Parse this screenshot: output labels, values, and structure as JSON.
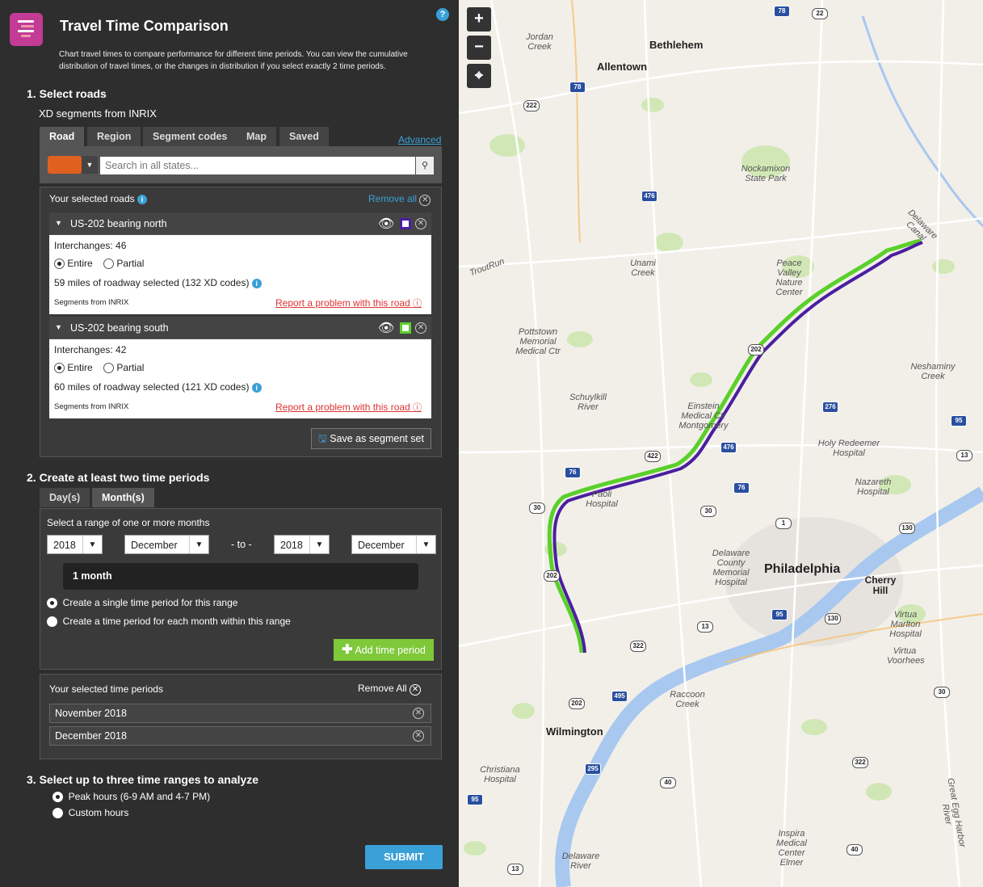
{
  "header": {
    "title": "Travel Time Comparison",
    "help": "?",
    "description": "Chart travel times to compare performance for different time periods. You can view the cumulative distribution of travel times, or the changes in distribution if you select exactly 2 time periods."
  },
  "step1": {
    "heading": "1. Select roads",
    "source": "XD segments from  INRIX",
    "tabs": [
      "Road",
      "Region",
      "Segment codes",
      "Map",
      "Saved"
    ],
    "active_tab": "Road",
    "advanced": "Advanced",
    "search_placeholder": "Search in all states...",
    "selected_label": "Your selected roads",
    "remove_all": "Remove all",
    "roads": [
      {
        "name": "US-202 bearing north",
        "interchanges": "Interchanges: 46",
        "entire": "Entire",
        "partial": "Partial",
        "miles": "59 miles of roadway selected (132 XD codes)",
        "segments_from": "Segments from INRIX",
        "report": "Report a problem with this road",
        "color": "#4b1fa0"
      },
      {
        "name": "US-202 bearing south",
        "interchanges": "Interchanges: 42",
        "entire": "Entire",
        "partial": "Partial",
        "miles": "60 miles of roadway selected (121 XD codes)",
        "segments_from": "Segments from INRIX",
        "report": "Report a problem with this road",
        "color": "#5ad02a"
      }
    ],
    "save_set": "Save as segment set"
  },
  "step2": {
    "heading": "2. Create at least two time periods",
    "tabs": [
      "Day(s)",
      "Month(s)"
    ],
    "active_tab": "Month(s)",
    "range_label": "Select a range of one or more months",
    "from_year": "2018",
    "from_month": "December",
    "to_label": "- to -",
    "to_year": "2018",
    "to_month": "December",
    "duration": "1 month",
    "option_single": "Create a single time period for this range",
    "option_each": "Create a time period for each month within this range",
    "add_period": "Add time period",
    "selected_label": "Your selected time periods",
    "remove_all": "Remove All",
    "periods": [
      "November 2018",
      "December 2018"
    ]
  },
  "step3": {
    "heading": "3. Select up to three time ranges to analyze",
    "option_peak": "Peak hours (6-9 AM and 4-7 PM)",
    "option_custom": "Custom hours",
    "submit": "SUBMIT"
  },
  "map": {
    "zoom_in": "+",
    "zoom_out": "−",
    "locate": "⌖",
    "cities": [
      "Bethlehem",
      "Allentown",
      "Philadelphia",
      "Wilmington",
      "Cherry Hill"
    ],
    "places": [
      "Jordan Creek",
      "Nockamixon State Park",
      "Unami Creek",
      "Peace Valley Nature Center",
      "Delaware Canal",
      "Pottstown Memorial Medical Ctr",
      "Schuylkill River",
      "Einstein Medical Ctr Montgomery",
      "Neshaminy Creek",
      "Holy Redeemer Hospital",
      "Nazareth Hospital",
      "Paoli Hospital",
      "Delaware County Memorial Hospital",
      "Virtua Marlton Hospital",
      "Virtua Voorhees",
      "Raccoon Creek",
      "Christiana Hospital",
      "Inspira Medical Center Elmer",
      "Delaware River",
      "Great Egg Harbor River",
      "TroutRun"
    ],
    "shields": [
      "78",
      "22",
      "78",
      "222",
      "476",
      "202",
      "276",
      "95",
      "422",
      "476",
      "13",
      "76",
      "76",
      "30",
      "30",
      "1",
      "130",
      "202",
      "95",
      "130",
      "13",
      "322",
      "495",
      "30",
      "202",
      "295",
      "322",
      "40",
      "95",
      "40",
      "13"
    ]
  }
}
